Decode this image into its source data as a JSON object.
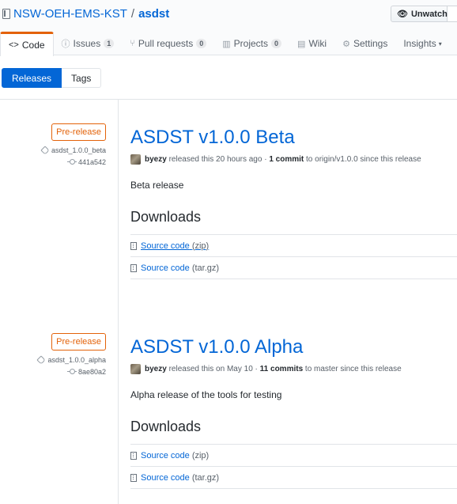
{
  "repo": {
    "owner": "NSW-OEH-EMS-KST",
    "separator": "/",
    "name": "asdst"
  },
  "watch": {
    "label": "Unwatch",
    "icon": "eye-icon"
  },
  "nav": {
    "code": "Code",
    "issues": "Issues",
    "issues_count": "1",
    "pulls": "Pull requests",
    "pulls_count": "0",
    "projects": "Projects",
    "projects_count": "0",
    "wiki": "Wiki",
    "settings": "Settings",
    "insights": "Insights"
  },
  "subnav": {
    "releases": "Releases",
    "tags": "Tags"
  },
  "releases": [
    {
      "badge": "Pre-release",
      "tag": "asdst_1.0.0_beta",
      "commit": "441a542",
      "title": "ASDST v1.0.0 Beta",
      "author": "byezy",
      "released": "released this 20 hours ago",
      "dot": "·",
      "commits": "1 commit",
      "branch_text": "to origin/v1.0.0 since this release",
      "description": "Beta release",
      "downloads_heading": "Downloads",
      "downloads": [
        {
          "label": "Source code",
          "format": "(zip)"
        },
        {
          "label": "Source code",
          "format": "(tar.gz)"
        }
      ]
    },
    {
      "badge": "Pre-release",
      "tag": "asdst_1.0.0_alpha",
      "commit": "8ae80a2",
      "title": "ASDST v1.0.0 Alpha",
      "author": "byezy",
      "released": "released this on May 10",
      "dot": "·",
      "commits": "11 commits",
      "branch_text": "to master since this release",
      "description": "Alpha release of the tools for testing",
      "downloads_heading": "Downloads",
      "downloads": [
        {
          "label": "Source code",
          "format": "(zip)"
        },
        {
          "label": "Source code",
          "format": "(tar.gz)"
        }
      ]
    }
  ],
  "colors": {
    "link": "#0366d6",
    "prerelease": "#e36209",
    "selected_tab_border": "#e36209"
  }
}
